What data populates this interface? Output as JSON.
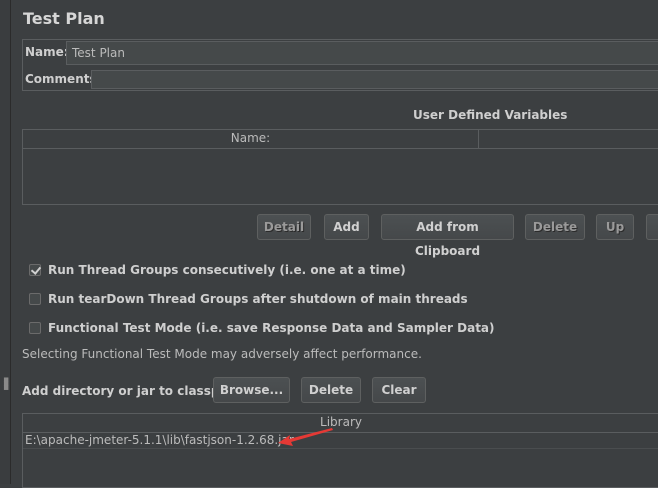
{
  "panel_title": "Test Plan",
  "name_label": "Name:",
  "name_value": "Test Plan",
  "comments_label": "Comments:",
  "udv": {
    "title": "User Defined Variables",
    "columns": [
      "Name:",
      ""
    ]
  },
  "udv_buttons": {
    "detail": "Detail",
    "add": "Add",
    "add_clipboard": "Add from Clipboard",
    "delete": "Delete",
    "up": "Up"
  },
  "options": [
    {
      "label": "Run Thread Groups consecutively (i.e. one at a time)",
      "checked": true
    },
    {
      "label": "Run tearDown Thread Groups after shutdown of main threads",
      "checked": false
    },
    {
      "label": "Functional Test Mode (i.e. save Response Data and Sampler Data)",
      "checked": false
    }
  ],
  "functional_note": "Selecting Functional Test Mode may adversely affect performance.",
  "classpath": {
    "label": "Add directory or jar to classpath",
    "browse": "Browse...",
    "delete": "Delete",
    "clear": "Clear",
    "column": "Library",
    "rows": [
      "E:\\apache-jmeter-5.1.1\\lib\\fastjson-1.2.68.jar"
    ]
  },
  "colors": {
    "annotation_arrow": "#e53935"
  }
}
